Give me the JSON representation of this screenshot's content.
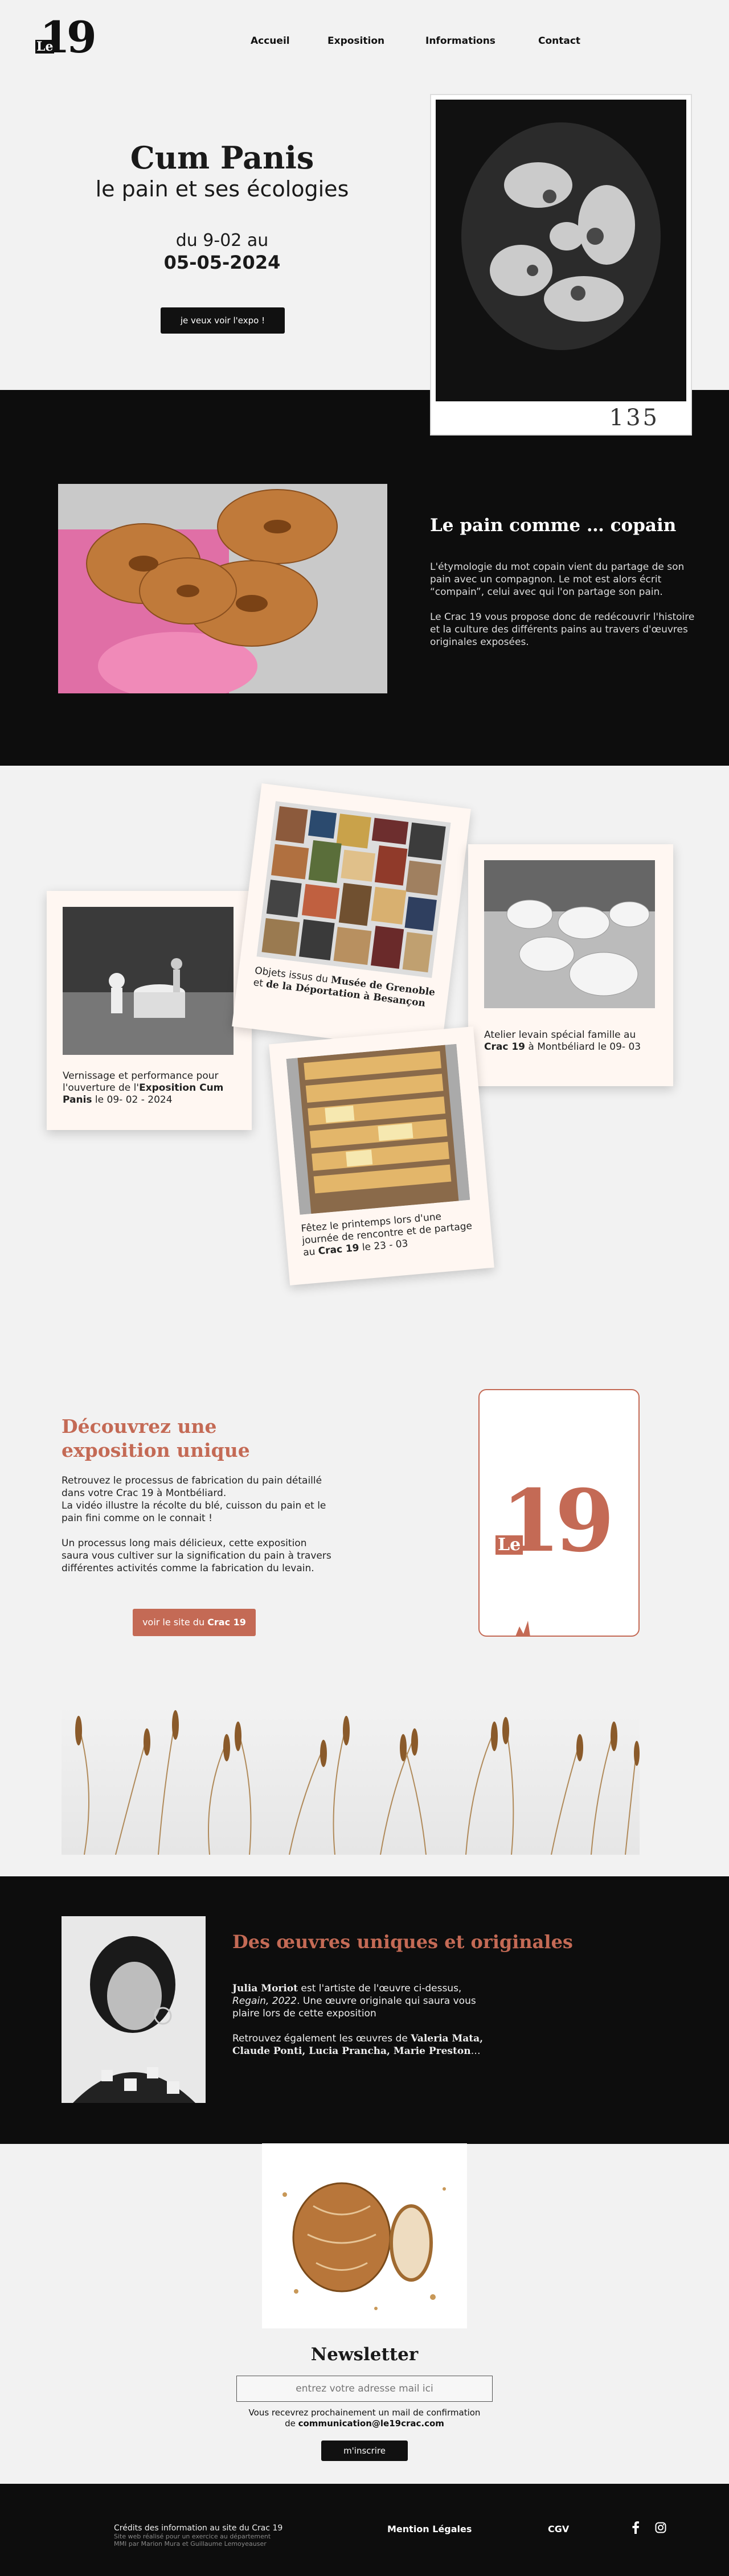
{
  "header": {
    "logo_main": "19",
    "logo_small": "Le",
    "nav": [
      "Accueil",
      "Exposition",
      "Informations",
      "Contact"
    ]
  },
  "hero": {
    "title": "Cum Panis",
    "subtitle": "le pain et ses écologies",
    "date_line1": "du 9-02 au",
    "date_line2": "05-05-2024",
    "button": "je veux voir l'expo !",
    "print_number": "135"
  },
  "copain": {
    "title": "Le pain comme … copain",
    "p1": "L'étymologie du mot copain vient du partage de son pain avec un compagnon. Le mot est alors écrit “compain”, celui avec qui l'on partage son pain.",
    "p2": "Le Crac 19 vous propose donc de redécouvrir l'histoire et la culture des différents pains au travers d'œuvres originales exposées."
  },
  "polaroids": {
    "p1": {
      "a": "Vernissage et performance pour l'ouverture de l'",
      "b": "Exposition Cum Panis",
      "c": " le 09- 02 - 2024"
    },
    "p2": {
      "a": "Objets issus du ",
      "b": "Musée de Grenoble",
      "c": " et ",
      "d": "de la Déportation à Besançon"
    },
    "p3": {
      "a": "Atelier levain spécial famille au ",
      "b": "Crac 19",
      "c": " à Montbéliard le 09- 03"
    },
    "p4": {
      "a": "Fêtez le printemps lors d'une journée de rencontre et de partage au ",
      "b": "Crac 19",
      "c": " le 23 - 03"
    }
  },
  "decouvrez": {
    "title": "Découvrez une exposition unique",
    "p1": "Retrouvez le processus de fabrication du pain détaillé dans votre Crac 19 à Montbéliard.",
    "p2": "La vidéo illustre la récolte du blé, cuisson du pain et le pain fini comme on le connait !",
    "p3": "Un processus long mais délicieux, cette exposition saura vous cultiver sur la signification du pain à travers différentes activités comme la fabrication du levain.",
    "button_a": "voir le site du ",
    "button_b": "Crac 19"
  },
  "oeuvres": {
    "title": "Des œuvres uniques et originales",
    "artist": "Julia Moriot",
    "p1_a": " est l'artiste de l'œuvre ci-dessus, ",
    "p1_italic": "Regain, 2022",
    "p1_b": ". Une œuvre originale qui saura vous plaire lors de cette exposition",
    "p2_a": "Retrouvez également les œuvres de ",
    "p2_names": "Valeria Mata, Claude Ponti, Lucia Prancha, Marie Preston",
    "p2_b": "…"
  },
  "newsletter": {
    "title": "Newsletter",
    "placeholder": "entrez votre adresse mail ici",
    "info1": "Vous recevrez prochainement un mail de confirmation",
    "info2_a": "de ",
    "email": "communication@le19crac.com",
    "button": "m'inscrire"
  },
  "footer": {
    "credits": "Crédits des information au site du Crac 19",
    "small1": "Site web réalisé pour un exercice au département",
    "small2": "MMI par Marion Mura et Guillaume Lemoyeauser",
    "legal": "Mention Légales",
    "cgv": "CGV",
    "icons": [
      "facebook-icon",
      "instagram-icon"
    ]
  },
  "colors": {
    "accent": "#c46a55",
    "dark": "#0d0d0d",
    "light": "#f2f2f2"
  }
}
